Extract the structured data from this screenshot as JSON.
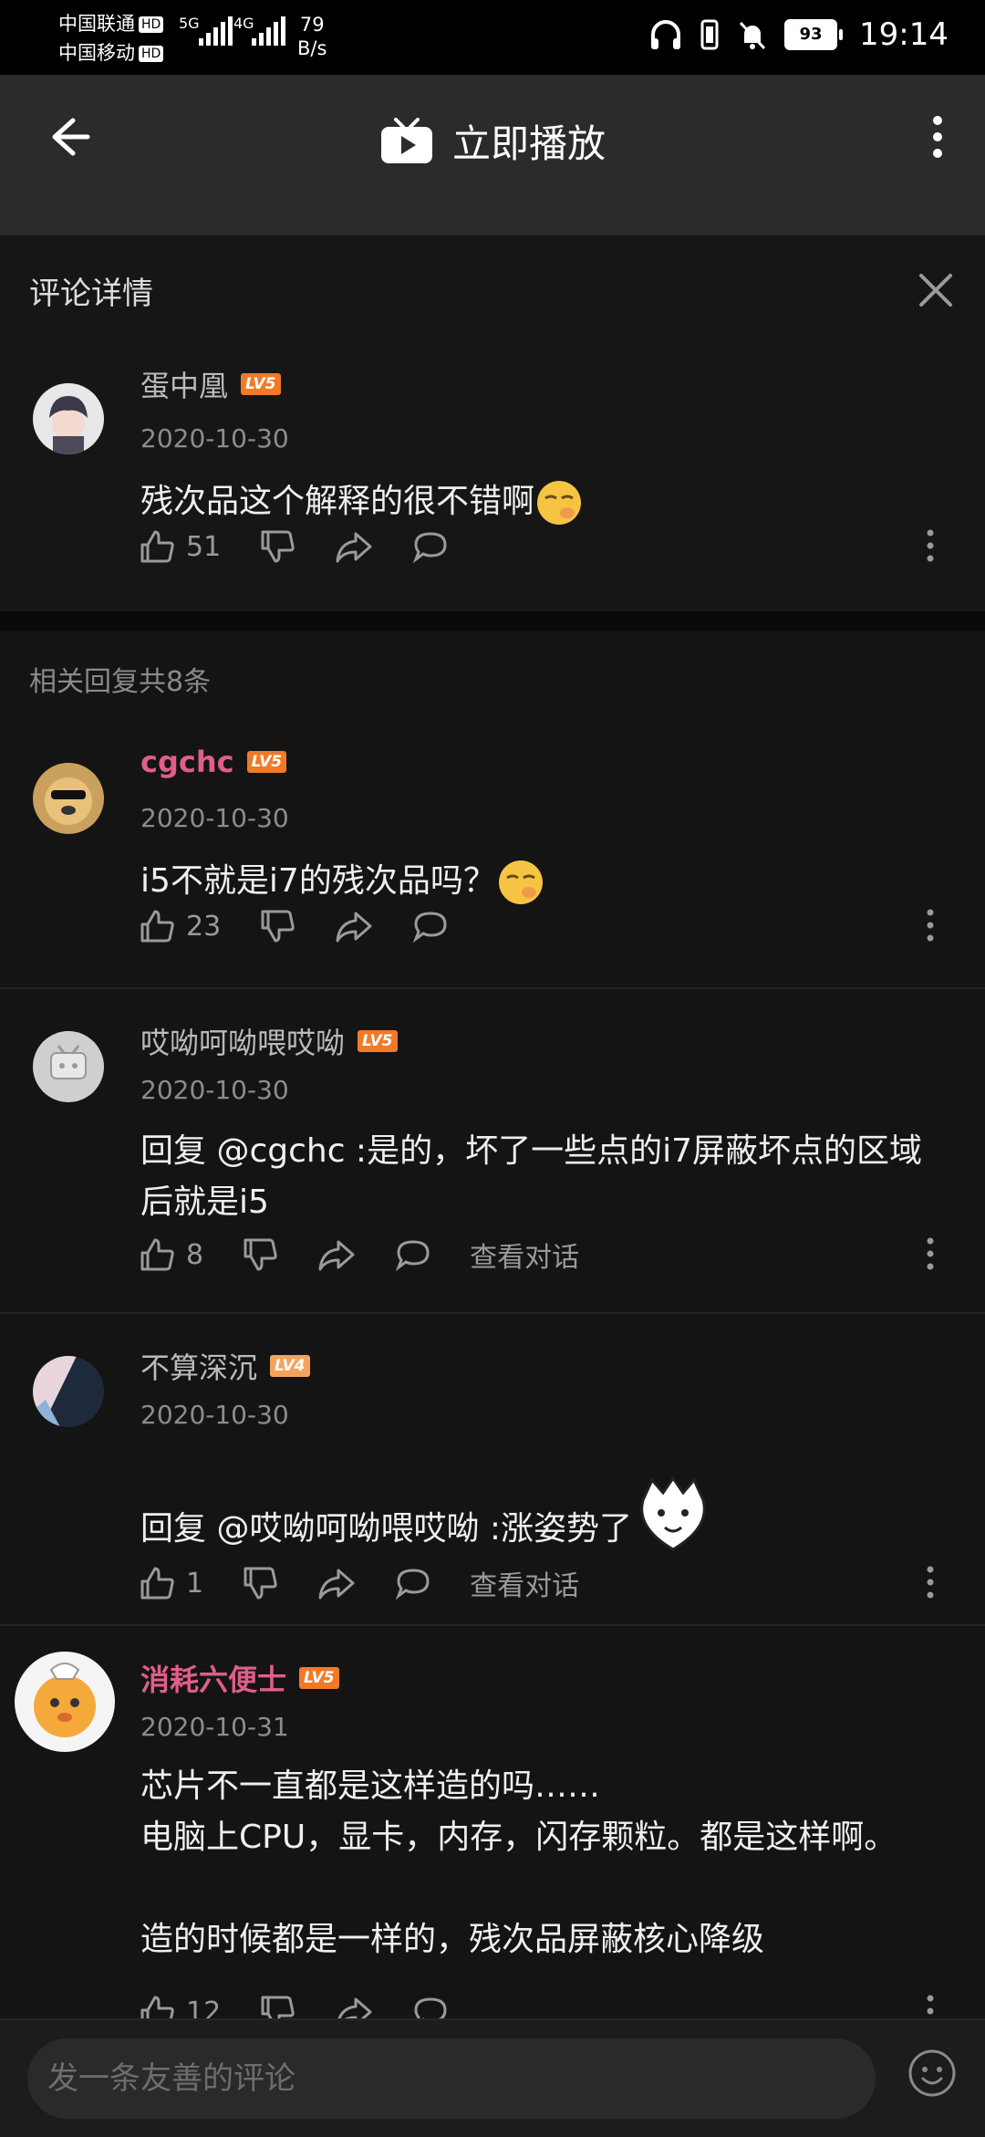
{
  "status_bar": {
    "carrier1": "中国联通",
    "carrier2": "中国移动",
    "hd": "HD",
    "net1": "5G",
    "net2": "4G",
    "speed_value": "79",
    "speed_unit": "B/s",
    "battery": "93",
    "time": "19:14"
  },
  "app_bar": {
    "title": "立即播放"
  },
  "panel": {
    "title": "评论详情"
  },
  "main_comment": {
    "user": "蛋中凰",
    "level": "LV5",
    "date": "2020-10-30",
    "text": "残次品这个解释的很不错啊",
    "likes": "51"
  },
  "replies_header": "相关回复共8条",
  "replies": [
    {
      "user": "cgchc",
      "level": "LV5",
      "date": "2020-10-30",
      "text": "i5不就是i7的残次品吗？",
      "likes": "23",
      "view_conversation": ""
    },
    {
      "user": "哎呦呵呦喂哎呦",
      "level": "LV5",
      "date": "2020-10-30",
      "text": "回复 @cgchc :是的，坏了一些点的i7屏蔽坏点的区域后就是i5",
      "likes": "8",
      "view_conversation": "查看对话"
    },
    {
      "user": "不算深沉",
      "level": "LV4",
      "date": "2020-10-30",
      "text": "回复 @哎呦呵呦喂哎呦 :涨姿势了",
      "likes": "1",
      "view_conversation": "查看对话"
    },
    {
      "user": "消耗六便士",
      "level": "LV5",
      "date": "2020-10-31",
      "text": "芯片不一直都是这样造的吗……\n电脑上CPU，显卡，内存，闪存颗粒。都是这样啊。\n\n造的时候都是一样的，残次品屏蔽核心降级",
      "likes": "12",
      "view_conversation": ""
    }
  ],
  "input": {
    "placeholder": "发一条友善的评论"
  },
  "colors": {
    "vip_name": "#e05d8c",
    "level_badge": "#f07a28"
  }
}
